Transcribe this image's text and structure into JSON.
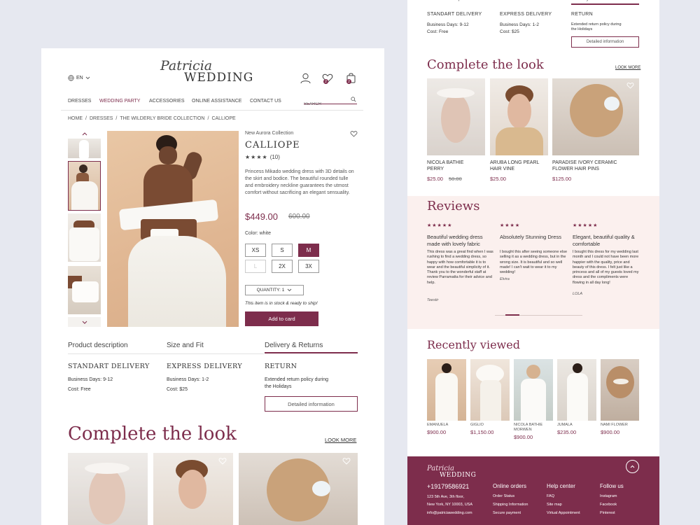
{
  "brand": {
    "script": "Patricia",
    "name": "WEDDING"
  },
  "header": {
    "lang": "EN"
  },
  "nav": [
    "DRESSES",
    "WEDDING PARTY",
    "ACCESSORIES",
    "ONLINE ASSISTANCE",
    "CONTACT US"
  ],
  "search": {
    "placeholder": "SEARCH"
  },
  "breadcrumb": [
    "HOME",
    "DRESSES",
    "THE WILDERLY BRIDE COLLECTION",
    "CALLIOPE"
  ],
  "badges": {
    "wishlist": "2",
    "cart": "2"
  },
  "product": {
    "collection": "New Aurora Collection",
    "name": "CALLIOPE",
    "rating": "★★★★",
    "reviews": "(10)",
    "description": "Princess Mikado wedding dress with 3D details on the skirt and bodice. The beautiful rounded tulle and embroidery neckline guarantees the utmost comfort without sacrificing an elegant sensuality.",
    "price": "$449.00",
    "old_price": "600.00",
    "color_label": "Color: white",
    "sizes": [
      "XS",
      "S",
      "M",
      "L",
      "2X",
      "3X"
    ],
    "quantity": "QUANTITY: 1",
    "stock": "This item is in stock & ready to ship!",
    "add_to_card": "Add to card"
  },
  "tabs": [
    "Product description",
    "Size and Fit",
    "Delivery & Returns"
  ],
  "delivery": [
    {
      "title": "STANDART DELIVERY",
      "l1": "Business Days: 9-12",
      "l2": "Cost: Free"
    },
    {
      "title": "EXPRESS DELIVERY",
      "l1": "Business Days: 1-2",
      "l2": "Cost: $25"
    },
    {
      "title": "RETURN",
      "l1": "Extended return policy during",
      "l2": "the Holidays"
    }
  ],
  "detailed_btn": "Detailed information",
  "complete": {
    "title": "Complete the look",
    "more": "LOOK MORE"
  },
  "look_items": [
    {
      "name1": "NICOLA BATHIE",
      "name2": "PERRY",
      "price": "$25.00",
      "old": "50.00"
    },
    {
      "name1": "ARUBA LONG PEARL",
      "name2": "HAIR VINE",
      "price": "$25.00",
      "old": ""
    },
    {
      "name1": "PARADISE IVORY CERAMIC",
      "name2": "FLOWER HAIR PINS",
      "price": "$125.00",
      "old": ""
    }
  ],
  "reviews": {
    "title": "Reviews",
    "items": [
      {
        "stars": "★★★★★",
        "title": "Beautiful wedding dress made with lovely fabric",
        "text": "This dress was a great find when I was rushing to find a wedding dress, so happy with how comfortable it is to wear and the beautiful simplicity of it. Thank you to the wonderful staff at review Parramatta for their advice and help.",
        "author": "Teestir"
      },
      {
        "stars": "★★★★",
        "title": "Absolutely Stunning Dress",
        "text": "I bought this after seeing someone else selling it as a wedding dress, but in the wrong size. It is beautiful and so well made! I can't wait to wear it to my wedding!",
        "author": "Elvira"
      },
      {
        "stars": "★★★★★",
        "title": "Elegant, beautiful quality & comfortable",
        "text": "I bought this dress for my wedding last month and I could not have been more happier with the quality, price and beauty of this dress. I felt just like a princess and all of my guests loved my dress and the compliments were flowing in all day long!",
        "author": "LOLA"
      }
    ]
  },
  "recent": {
    "title": "Recently viewed",
    "items": [
      {
        "name": "EMANUELA",
        "price": "$900.00"
      },
      {
        "name": "GIGLIO",
        "price": "$1,150.00"
      },
      {
        "name": "NICOLA BATHIE MORWEN",
        "price": "$900.00"
      },
      {
        "name": "JUMALA",
        "price": "$235.00"
      },
      {
        "name": "NAMI FLOWER",
        "price": "$900.00"
      }
    ]
  },
  "footer": {
    "phone": "+19179586921",
    "address1": "123 5th Ave, 3th floor,",
    "address2": "New York, NY 10003, USA",
    "email": "info@patriciawedding.com",
    "cols": [
      {
        "title": "Online orders",
        "links": [
          "Order Status",
          "Shipping Information",
          "Secure payment"
        ]
      },
      {
        "title": "Help center",
        "links": [
          "FAQ",
          "Site map",
          "Virtual Appointment"
        ]
      },
      {
        "title": "Follow us",
        "links": [
          "Instagram",
          "Facebook",
          "Pinterest"
        ]
      }
    ]
  },
  "colors": {
    "accent": "#7d2d4c",
    "review_bg": "#fbf0ee",
    "footer_bg": "#7d2d4c",
    "page_bg": "#e6e8f0"
  }
}
